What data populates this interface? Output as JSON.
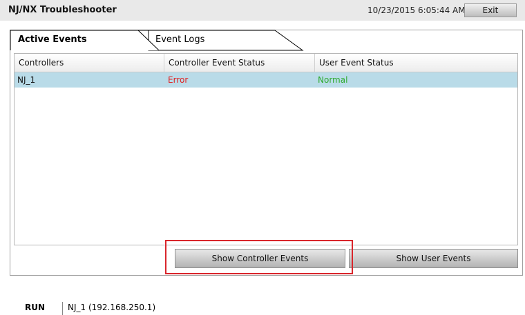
{
  "app": {
    "title": "NJ/NX Troubleshooter",
    "datetime": "10/23/2015 6:05:44 AM",
    "exit_label": "Exit"
  },
  "tabs": [
    {
      "label": "Active Events",
      "active": true
    },
    {
      "label": "Event Logs",
      "active": false
    }
  ],
  "table": {
    "columns": [
      "Controllers",
      "Controller Event Status",
      "User Event Status"
    ],
    "rows": [
      {
        "controller": "NJ_1",
        "controller_status": "Error",
        "user_status": "Normal"
      }
    ]
  },
  "buttons": {
    "show_controller_events": "Show Controller Events",
    "show_user_events": "Show User Events"
  },
  "status_bar": {
    "mode": "RUN",
    "controller": "NJ_1 (192.168.250.1)"
  },
  "colors": {
    "error": "#e02020",
    "normal": "#2eaa2e",
    "selected_row": "#b9dbe8",
    "highlight": "#d9252b"
  }
}
